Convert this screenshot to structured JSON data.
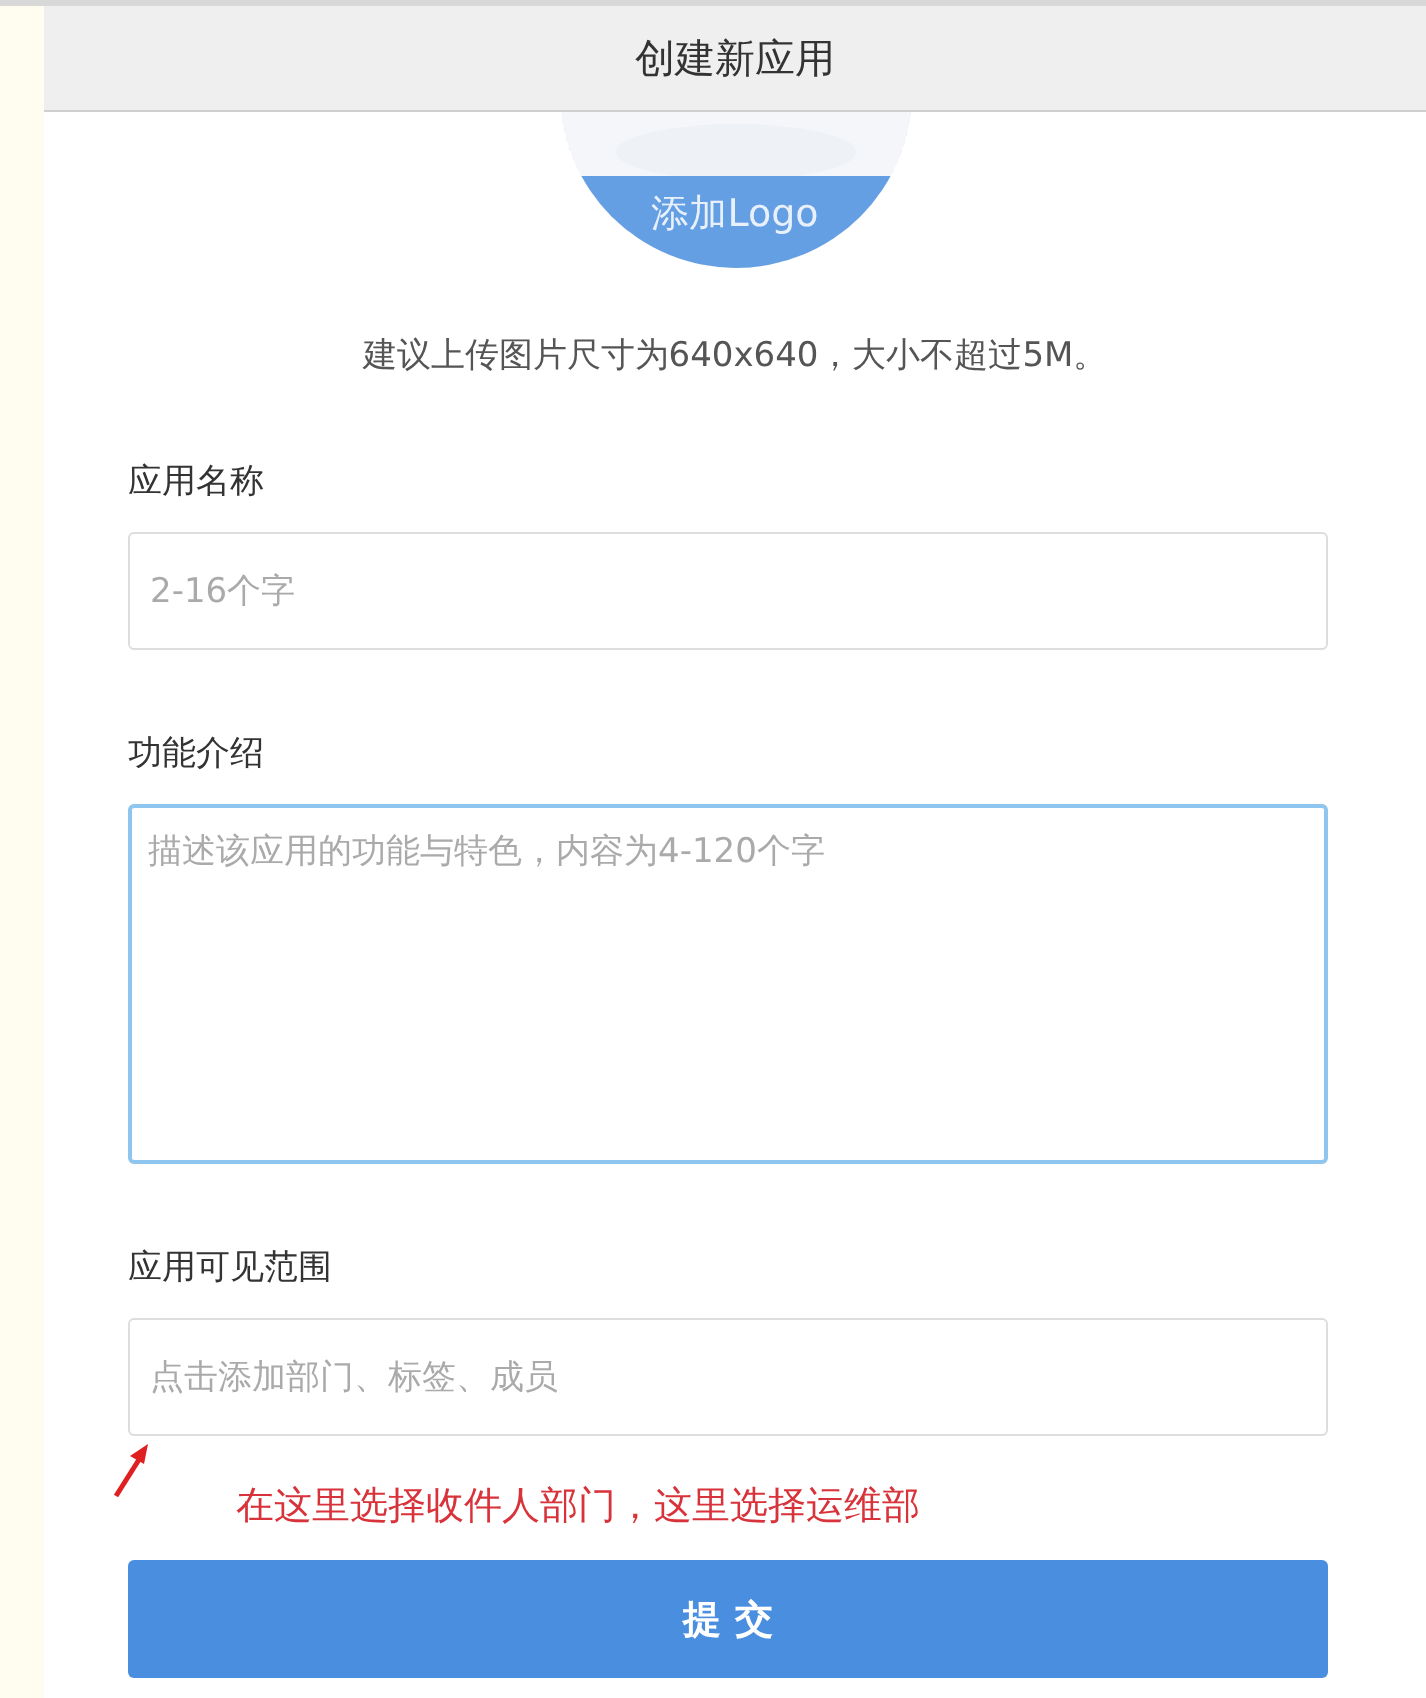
{
  "header": {
    "title": "创建新应用"
  },
  "logo": {
    "label": "添加Logo"
  },
  "hint": "建议上传图片尺寸为640x640，大小不超过5M。",
  "fields": [
    {
      "kind": "input",
      "label": "应用名称",
      "placeholder": "2-16个字",
      "focused": false
    },
    {
      "kind": "textarea",
      "label": "功能介绍",
      "placeholder": "描述该应用的功能与特色，内容为4-120个字",
      "focused": true
    },
    {
      "kind": "input",
      "label": "应用可见范围",
      "placeholder": "点击添加部门、标签、成员",
      "focused": false
    }
  ],
  "annotation": "在这里选择收件人部门，这里选择运维部",
  "submit": "提 交"
}
